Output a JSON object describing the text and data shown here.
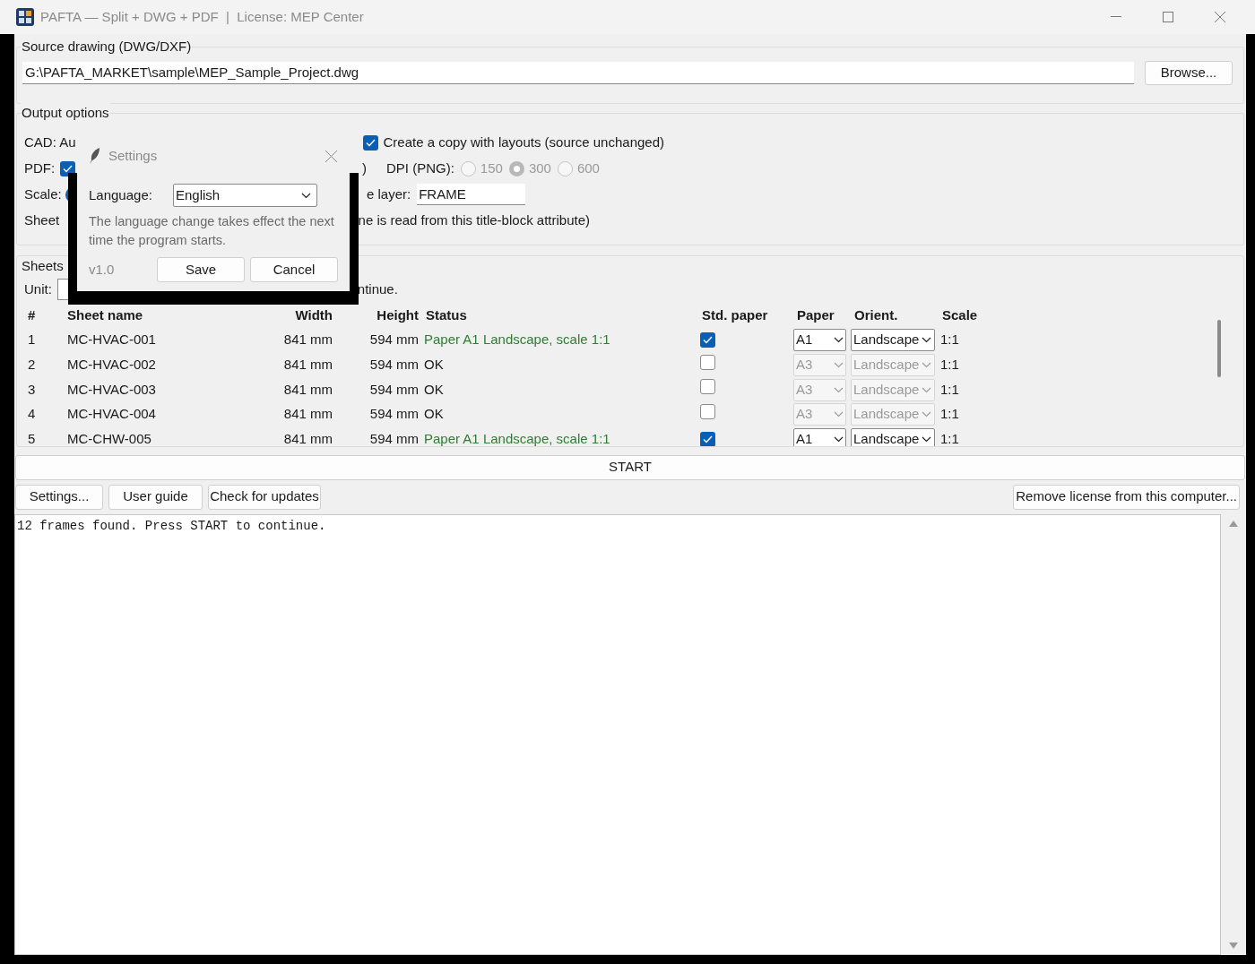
{
  "window": {
    "title": "PAFTA — Split + DWG + PDF  |  License: MEP Center"
  },
  "source": {
    "legend": "Source drawing (DWG/DXF)",
    "path": "G:\\PAFTA_MARKET\\sample\\MEP_Sample_Project.dwg",
    "browse": "Browse..."
  },
  "output": {
    "legend": "Output options",
    "cad_label": "CAD: Au",
    "copy_layouts": {
      "label": "Create a copy with layouts (source unchanged)",
      "checked": true
    },
    "pdf_label": "PDF:",
    "pdf": {
      "checked": true
    },
    "fragment": ")",
    "dpi_label": "DPI (PNG):",
    "dpi_disabled": true,
    "dpi_options": [
      {
        "label": "150",
        "selected": false
      },
      {
        "label": "300",
        "selected": true
      },
      {
        "label": "600",
        "selected": false
      }
    ],
    "scale_label": "Scale:",
    "scale_radio": {
      "selected": true
    },
    "layer_label": "e layer:",
    "layer_value": "FRAME",
    "sheet_label": "Sheet",
    "sheet_note": "ne is read from this title-block attribute)"
  },
  "sheets": {
    "legend": "Sheets",
    "unit_label": "Unit:",
    "hint": "ntinue.",
    "columns": [
      "#",
      "Sheet name",
      "Width",
      "Height",
      "Status",
      "Std. paper",
      "Paper",
      "Orient.",
      "Scale"
    ],
    "rows": [
      {
        "num": "1",
        "name": "MC-HVAC-001",
        "width": "841 mm",
        "height": "594 mm",
        "status": "Paper A1 Landscape, scale 1:1",
        "kind": "paper",
        "std_paper": true,
        "paper": "A1",
        "orient": "Landscape",
        "scale": "1:1"
      },
      {
        "num": "2",
        "name": "MC-HVAC-002",
        "width": "841 mm",
        "height": "594 mm",
        "status": "OK",
        "kind": "ok",
        "std_paper": false,
        "paper": "A3",
        "orient": "Landscape",
        "scale": "1:1"
      },
      {
        "num": "3",
        "name": "MC-HVAC-003",
        "width": "841 mm",
        "height": "594 mm",
        "status": "OK",
        "kind": "ok",
        "std_paper": false,
        "paper": "A3",
        "orient": "Landscape",
        "scale": "1:1"
      },
      {
        "num": "4",
        "name": "MC-HVAC-004",
        "width": "841 mm",
        "height": "594 mm",
        "status": "OK",
        "kind": "ok",
        "std_paper": false,
        "paper": "A3",
        "orient": "Landscape",
        "scale": "1:1"
      },
      {
        "num": "5",
        "name": "MC-CHW-005",
        "width": "841 mm",
        "height": "594 mm",
        "status": "Paper A1 Landscape, scale 1:1",
        "kind": "paper",
        "std_paper": true,
        "paper": "A1",
        "orient": "Landscape",
        "scale": "1:1"
      }
    ]
  },
  "buttons": {
    "start": "START",
    "settings": "Settings...",
    "guide": "User guide",
    "updates": "Check for updates",
    "remove": "Remove license from this computer..."
  },
  "log": "12 frames found. Press START to continue.",
  "dialog": {
    "title": "Settings",
    "language_label": "Language:",
    "language": "English",
    "note": "The language change takes effect the next time the program starts.",
    "version": "v1.0",
    "save": "Save",
    "cancel": "Cancel"
  }
}
